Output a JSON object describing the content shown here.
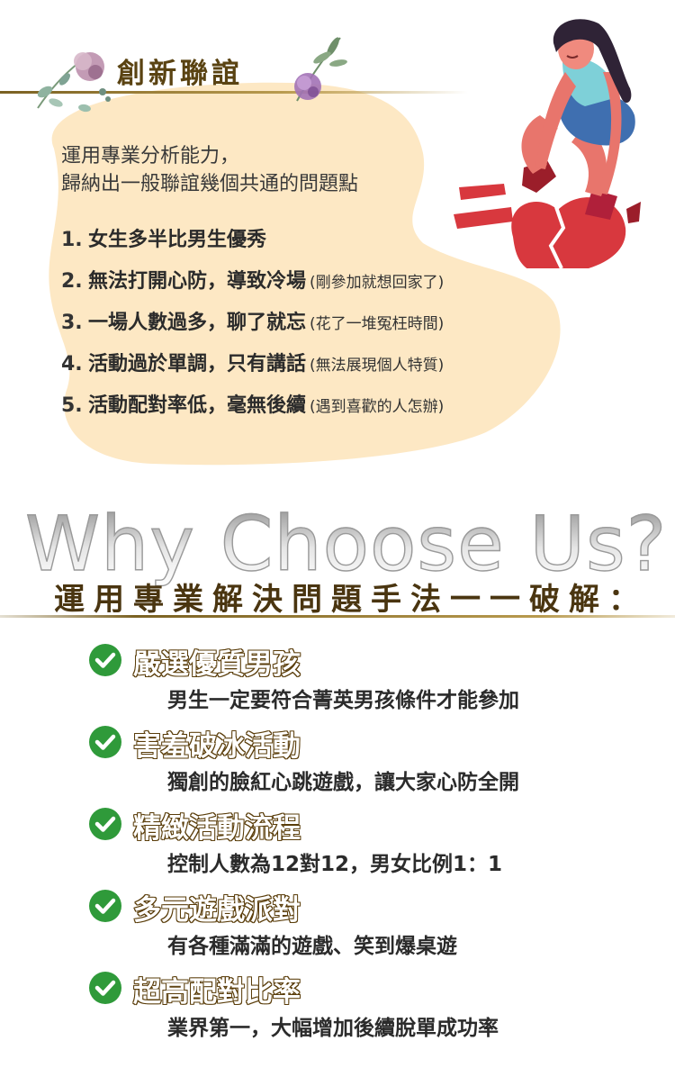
{
  "header": {
    "title": "創新聯誼"
  },
  "intro": {
    "line1": "運用專業分析能力，",
    "line2": "歸納出一般聯誼幾個共通的問題點"
  },
  "problems": [
    {
      "num": "1.",
      "text": "女生多半比男生優秀",
      "note": ""
    },
    {
      "num": "2.",
      "text": "無法打開心防，導致冷場",
      "note": "(剛參加就想回家了)"
    },
    {
      "num": "3.",
      "text": "一場人數過多，聊了就忘",
      "note": "(花了一堆冤枉時間)"
    },
    {
      "num": "4.",
      "text": "活動過於單調，只有講話",
      "note": "(無法展現個人特質)"
    },
    {
      "num": "5.",
      "text": "活動配對率低，毫無後續",
      "note": "(遇到喜歡的人怎辦)"
    }
  ],
  "why": {
    "headline": "Why Choose Us?",
    "subtitle": "運用專業解決問題手法一一破解："
  },
  "features": [
    {
      "title": "嚴選優質男孩",
      "desc": "男生一定要符合菁英男孩條件才能參加"
    },
    {
      "title": "害羞破冰活動",
      "desc": "獨創的臉紅心跳遊戲，讓大家心防全開"
    },
    {
      "title": "精緻活動流程",
      "desc": "控制人數為12對12，男女比例1：1"
    },
    {
      "title": "多元遊戲派對",
      "desc": "有各種滿滿的遊戲、笑到爆桌遊"
    },
    {
      "title": "超高配對比率",
      "desc": "業界第一，大幅增加後續脫單成功率"
    }
  ],
  "colors": {
    "blob": "#fde8c4",
    "gold": "#7a6122",
    "check": "#2f9a3a",
    "heart": "#d8383e"
  }
}
